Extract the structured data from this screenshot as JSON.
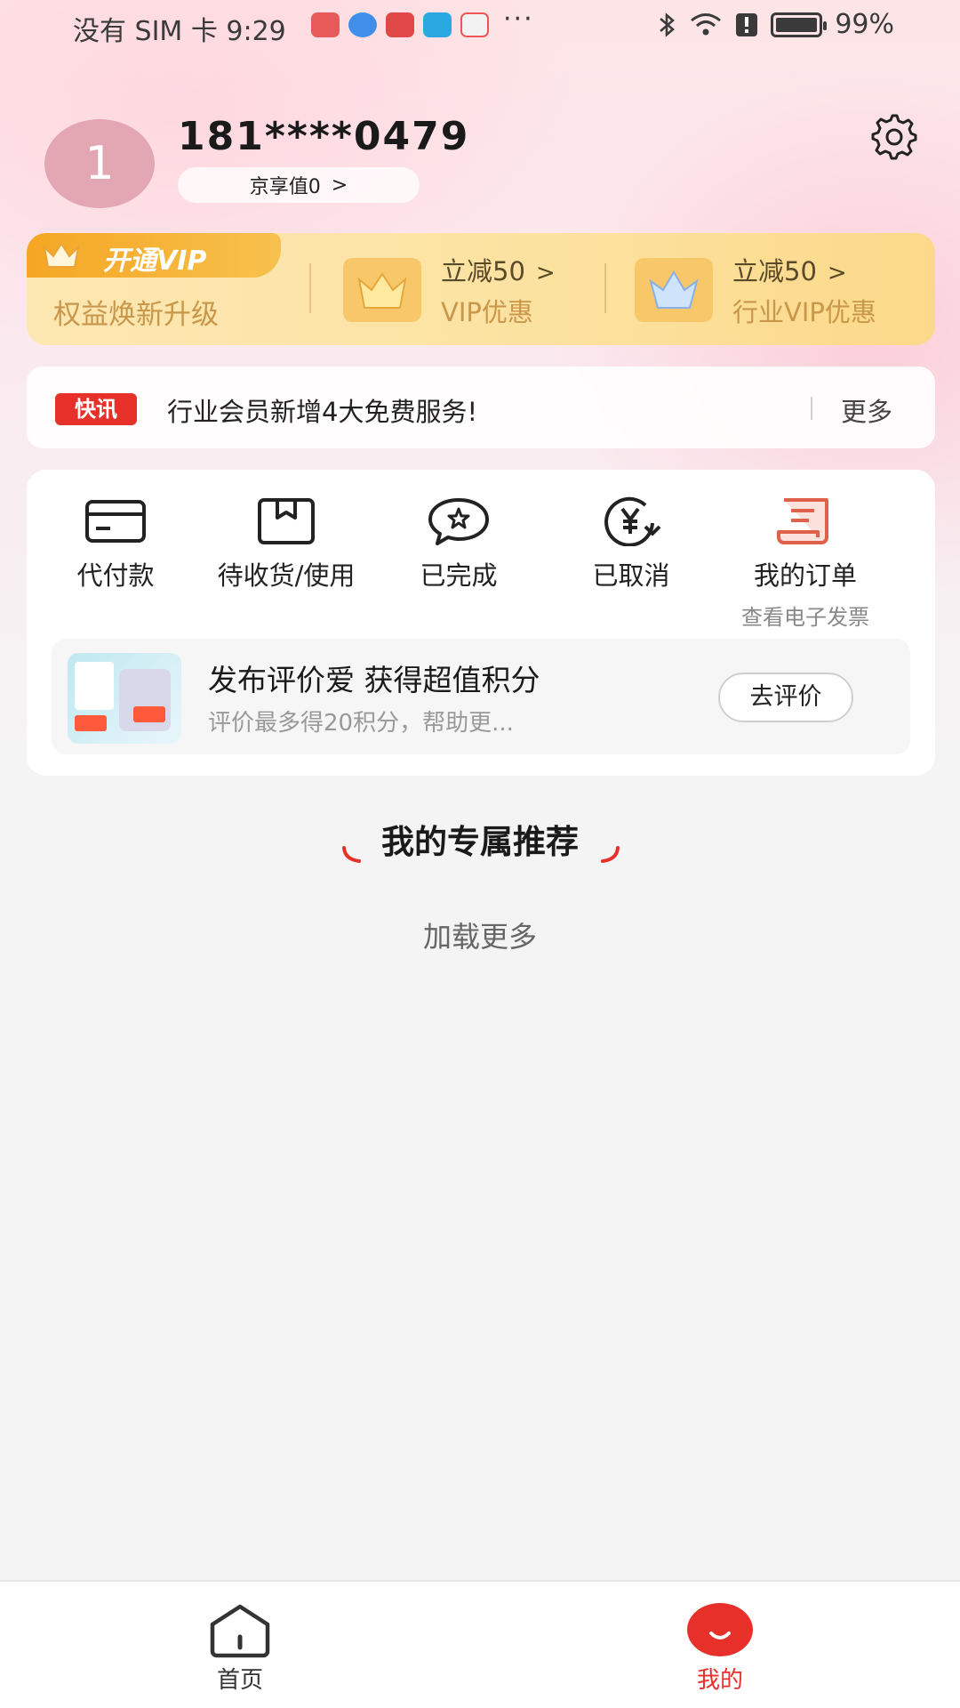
{
  "status_bar": {
    "carrier_time": "没有 SIM 卡 9:29",
    "more_dots": "···",
    "battery_text": "99%",
    "battery_level": 0.99
  },
  "profile": {
    "avatar_text": "1",
    "phone": "181****0479",
    "jingxiang_label": "京享值0",
    "jingxiang_chevron": ">"
  },
  "vip": {
    "tag_label": "开通VIP",
    "subtitle": "权益焕新升级",
    "offers": [
      {
        "title": "立减50",
        "chevron": ">",
        "subtitle": "VIP优惠"
      },
      {
        "title": "立减50",
        "chevron": ">",
        "subtitle": "行业VIP优惠"
      }
    ]
  },
  "news": {
    "tag": "快讯",
    "text": "行业会员新增4大免费服务!",
    "more": "更多"
  },
  "orders": {
    "items": [
      {
        "label": "代付款"
      },
      {
        "label": "待收货/使用"
      },
      {
        "label": "已完成"
      },
      {
        "label": "已取消"
      },
      {
        "label": "我的订单",
        "sub": "查看电子发票"
      }
    ],
    "review": {
      "title": "发布评价爱 获得超值积分",
      "subtitle": "评价最多得20积分，帮助更...",
      "button": "去评价"
    }
  },
  "recommend": {
    "title": "我的专属推荐",
    "load_more": "加载更多"
  },
  "bottom_nav": {
    "items": [
      {
        "label": "首页"
      },
      {
        "label": "我的"
      }
    ]
  },
  "colors": {
    "accent_red": "#e8302a",
    "vip_gold": "#c9974a",
    "active_tab": "#e8302a"
  }
}
